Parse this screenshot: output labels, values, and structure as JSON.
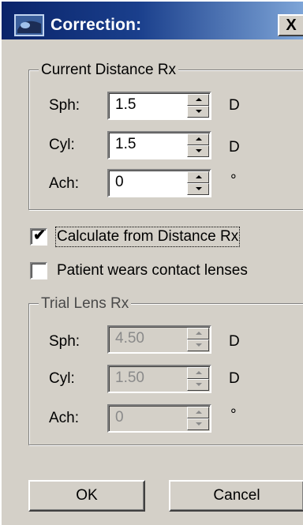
{
  "window": {
    "title": "Correction:",
    "close_label": "X"
  },
  "distance_group": {
    "legend": "Current Distance Rx",
    "fields": [
      {
        "label": "Sph:",
        "value": "1.5",
        "unit": "D"
      },
      {
        "label": "Cyl:",
        "value": "1.5",
        "unit": "D"
      },
      {
        "label": "Ach:",
        "value": "0",
        "unit": "°"
      }
    ]
  },
  "options": {
    "calculate": {
      "label": "Calculate from Distance Rx",
      "checked": true,
      "check_glyph": "✔"
    },
    "contacts": {
      "label": "Patient wears contact lenses",
      "checked": false
    }
  },
  "trial_group": {
    "legend": "Trial Lens Rx",
    "fields": [
      {
        "label": "Sph:",
        "value": "4.50",
        "unit": "D"
      },
      {
        "label": "Cyl:",
        "value": "1.50",
        "unit": "D"
      },
      {
        "label": "Ach:",
        "value": "0",
        "unit": "°"
      }
    ]
  },
  "buttons": {
    "ok": "OK",
    "cancel": "Cancel"
  }
}
